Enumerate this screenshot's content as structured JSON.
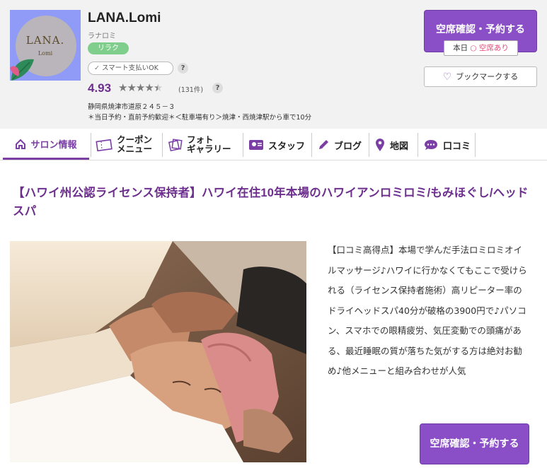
{
  "logo": {
    "line1": "LANA.",
    "line2": "Lomi"
  },
  "salon": {
    "name": "LANA.Lomi",
    "kana": "ラナロミ",
    "badge": "リラク",
    "payment": "スマート支払いOK",
    "rating": "4.93",
    "star_count": 4.5,
    "review_count": "(131件)",
    "address": "静岡県焼津市道原２４５－３",
    "access": "＊当日予約・直前予約歓迎＊＜駐車場有り＞焼津・西焼津駅から車で10分"
  },
  "actions": {
    "reserve_label": "空席確認・予約する",
    "availability_day": "本日",
    "availability_status": "○ 空席あり",
    "bookmark_label": "ブックマークする"
  },
  "tabs": [
    {
      "label": "サロン情報",
      "icon": "home-icon"
    },
    {
      "label": "クーポン\nメニュー",
      "icon": "coupon-icon"
    },
    {
      "label": "フォト\nギャラリー",
      "icon": "photo-icon"
    },
    {
      "label": "スタッフ",
      "icon": "staff-icon"
    },
    {
      "label": "ブログ",
      "icon": "pen-icon"
    },
    {
      "label": "地図",
      "icon": "map-pin-icon"
    },
    {
      "label": "口コミ",
      "icon": "chat-icon"
    }
  ],
  "headline": "【ハワイ州公認ライセンス保持者】ハワイ在住10年本場のハワイアンロミロミ/もみほぐし/ヘッドスパ",
  "description": "【口コミ高得点】本場で学んだ手法ロミロミオイルマッサージ♪ハワイに行かなくてもここで受けられる（ライセンス保持者施術）高リピーター率のドライヘッドスパ40分が破格の3900円で♪パソコン、スマホでの眼精疲労、気圧変動での頭痛がある、最近睡眠の質が落ちた気がする方は絶対お勧め♪他メニューと組み合わせが人気",
  "colors": {
    "accent": "#7a3ea4",
    "button": "#8a4fc6",
    "badge": "#7fce8c",
    "available": "#e04a7a"
  }
}
